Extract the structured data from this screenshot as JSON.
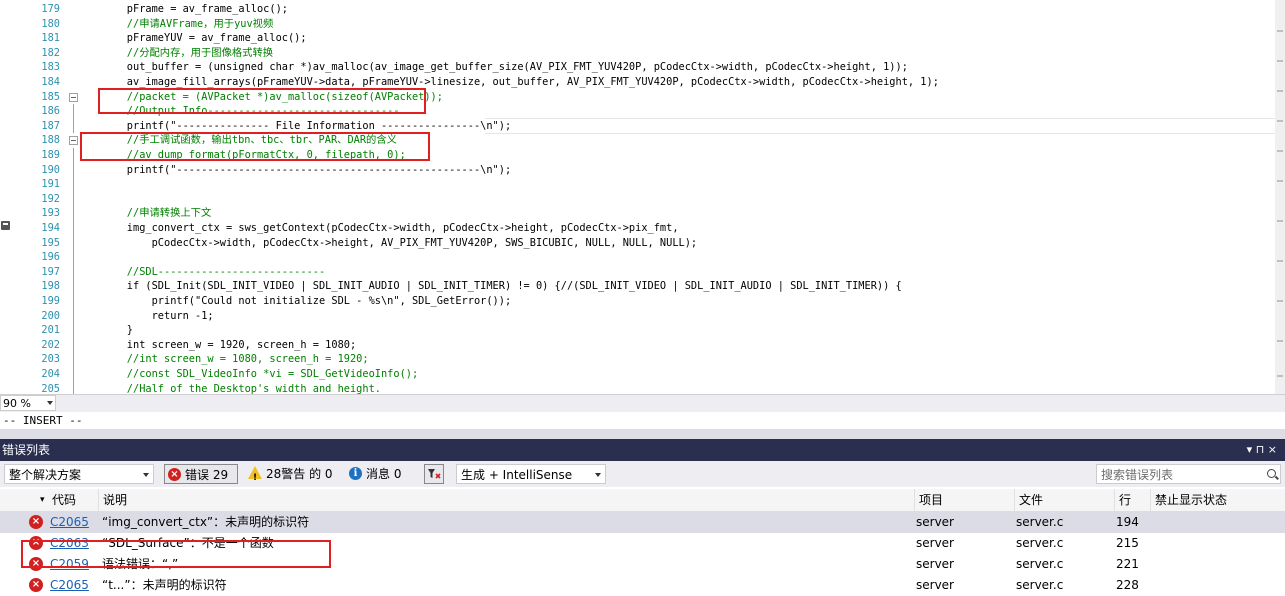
{
  "editor": {
    "lines": [
      {
        "num": "179",
        "code": "    pFrame = av_frame_alloc();",
        "cls": ""
      },
      {
        "num": "180",
        "code": "    //申请AVFrame，用于yuv视频",
        "cls": "c-green"
      },
      {
        "num": "181",
        "code": "    pFrameYUV = av_frame_alloc();",
        "cls": ""
      },
      {
        "num": "182",
        "code": "    //分配内存，用于图像格式转换",
        "cls": "c-green"
      },
      {
        "num": "183",
        "code": "    out_buffer = (unsigned char *)av_malloc(av_image_get_buffer_size(AV_PIX_FMT_YUV420P, pCodecCtx->width, pCodecCtx->height, 1));",
        "cls": ""
      },
      {
        "num": "184",
        "code": "    av_image_fill_arrays(pFrameYUV->data, pFrameYUV->linesize, out_buffer, AV_PIX_FMT_YUV420P, pCodecCtx->width, pCodecCtx->height, 1);",
        "cls": ""
      },
      {
        "num": "185",
        "code": "    //packet = (AVPacket *)av_malloc(sizeof(AVPacket));",
        "cls": "c-green"
      },
      {
        "num": "186",
        "code": "    //Output Info-------------------------------",
        "cls": "c-green"
      },
      {
        "num": "187",
        "code": "    printf(\"--------------- File Information ----------------\\n\");",
        "cls": ""
      },
      {
        "num": "188",
        "code": "    //手工调试函数，输出tbn、tbc、tbr、PAR、DAR的含义",
        "cls": "c-green"
      },
      {
        "num": "189",
        "code": "    //av_dump_format(pFormatCtx, 0, filepath, 0);",
        "cls": "c-green"
      },
      {
        "num": "190",
        "code": "    printf(\"-------------------------------------------------\\n\");",
        "cls": ""
      },
      {
        "num": "191",
        "code": "",
        "cls": ""
      },
      {
        "num": "192",
        "code": "",
        "cls": ""
      },
      {
        "num": "193",
        "code": "    //申请转换上下文",
        "cls": "c-green"
      },
      {
        "num": "194",
        "code": "    img_convert_ctx = sws_getContext(pCodecCtx->width, pCodecCtx->height, pCodecCtx->pix_fmt,",
        "cls": ""
      },
      {
        "num": "195",
        "code": "        pCodecCtx->width, pCodecCtx->height, AV_PIX_FMT_YUV420P, SWS_BICUBIC, NULL, NULL, NULL);",
        "cls": ""
      },
      {
        "num": "196",
        "code": "",
        "cls": ""
      },
      {
        "num": "197",
        "code": "    //SDL---------------------------",
        "cls": "c-green"
      },
      {
        "num": "198",
        "code": "    if (SDL_Init(SDL_INIT_VIDEO | SDL_INIT_AUDIO | SDL_INIT_TIMER) != 0) {//(SDL_INIT_VIDEO | SDL_INIT_AUDIO | SDL_INIT_TIMER)) {",
        "cls": ""
      },
      {
        "num": "199",
        "code": "        printf(\"Could not initialize SDL - %s\\n\", SDL_GetError());",
        "cls": ""
      },
      {
        "num": "200",
        "code": "        return -1;",
        "cls": ""
      },
      {
        "num": "201",
        "code": "    }",
        "cls": ""
      },
      {
        "num": "202",
        "code": "    int screen_w = 1920, screen_h = 1080;",
        "cls": ""
      },
      {
        "num": "203",
        "code": "    //int screen_w = 1080, screen_h = 1920;",
        "cls": "c-green"
      },
      {
        "num": "204",
        "code": "    //const SDL_VideoInfo *vi = SDL_GetVideoInfo();",
        "cls": "c-green"
      },
      {
        "num": "205",
        "code": "    //Half of the Desktop's width and height.",
        "cls": "c-green"
      }
    ]
  },
  "status": {
    "zoom": "90 %",
    "mode": "-- INSERT --"
  },
  "error_list": {
    "title": "错误列表",
    "title_icons": "▾ ⊓ ×",
    "scope": "整个解决方案",
    "errors_label": "错误 29",
    "warnings_label": "28警告 的 0",
    "messages_label": "消息 0",
    "build_filter": "生成 + IntelliSense",
    "search_placeholder": "搜索错误列表",
    "columns": {
      "code": "代码",
      "desc": "说明",
      "project": "项目",
      "file": "文件",
      "line": "行",
      "suppress": "禁止显示状态"
    },
    "rows": [
      {
        "code": "C2065",
        "desc": "“img_convert_ctx”：未声明的标识符",
        "project": "server",
        "file": "server.c",
        "line": "194"
      },
      {
        "code": "C2063",
        "desc": "“SDL_Surface”：不是一个函数",
        "project": "server",
        "file": "server.c",
        "line": "215"
      },
      {
        "code": "C2059",
        "desc": "语法错误：“,”",
        "project": "server",
        "file": "server.c",
        "line": "221"
      },
      {
        "code": "C2065",
        "desc": "“t...”：未声明的标识符",
        "project": "server",
        "file": "server.c",
        "line": "228"
      }
    ]
  }
}
